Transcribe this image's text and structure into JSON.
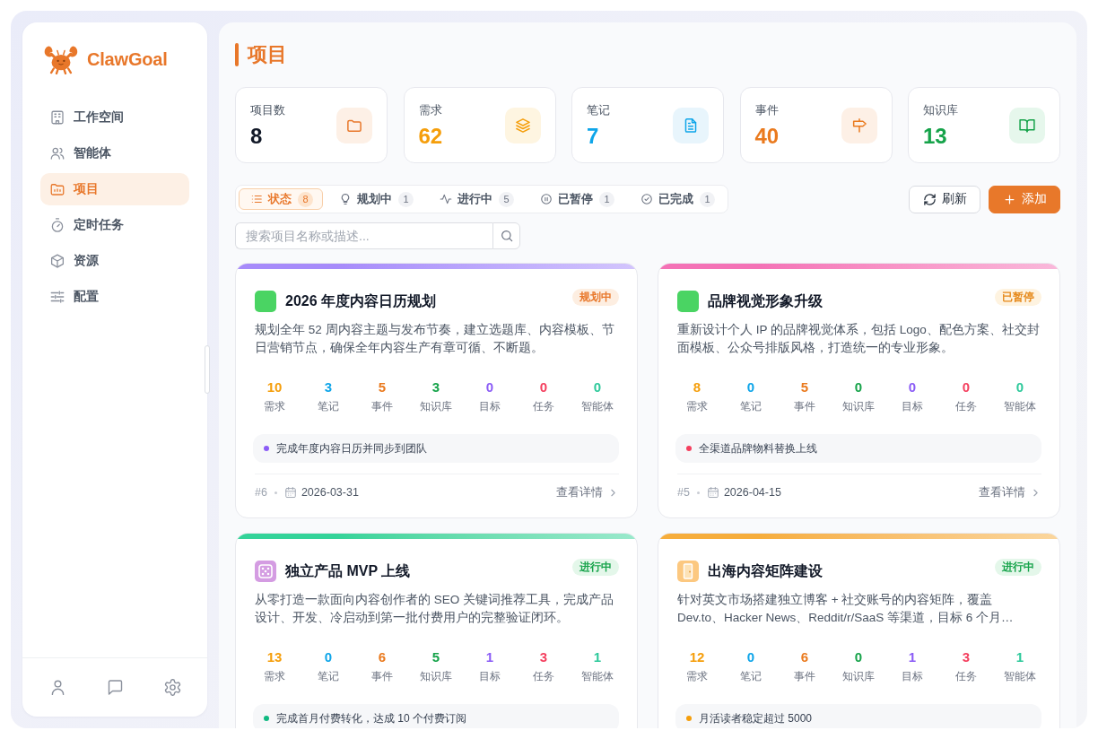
{
  "sidebar": {
    "logo": "ClawGoal",
    "items": [
      {
        "label": "工作空间",
        "selected": false
      },
      {
        "label": "智能体",
        "selected": false
      },
      {
        "label": "项目",
        "selected": true
      },
      {
        "label": "定时任务",
        "selected": false
      },
      {
        "label": "资源",
        "selected": false
      },
      {
        "label": "配置",
        "selected": false
      }
    ]
  },
  "header": {
    "title": "项目"
  },
  "stats": [
    {
      "label": "项目数",
      "value": "8",
      "color": "#111827"
    },
    {
      "label": "需求",
      "value": "62",
      "color": "#f59e0b"
    },
    {
      "label": "笔记",
      "value": "7",
      "color": "#0ea5e9"
    },
    {
      "label": "事件",
      "value": "40",
      "color": "#ea7a1e"
    },
    {
      "label": "知识库",
      "value": "13",
      "color": "#16a34a"
    }
  ],
  "filter_tabs": [
    {
      "label": "状态",
      "count": "8",
      "selected": true
    },
    {
      "label": "规划中",
      "count": "1",
      "selected": false
    },
    {
      "label": "进行中",
      "count": "5",
      "selected": false
    },
    {
      "label": "已暂停",
      "count": "1",
      "selected": false
    },
    {
      "label": "已完成",
      "count": "1",
      "selected": false
    }
  ],
  "actions": [
    {
      "label": "刷新",
      "kind": "secondary"
    },
    {
      "label": "添加",
      "kind": "primary"
    }
  ],
  "search": {
    "placeholder": "搜索项目名称或描述..."
  },
  "projects": [
    {
      "title": "2026 年度内容日历规划",
      "color": "#a78bfa",
      "icon": {
        "color": "#4ad463"
      },
      "status": {
        "label": "规划中",
        "kind": "planning"
      },
      "description": "规划全年 52 周内容主题与发布节奏，建立选题库、内容模板、节日营销节点，确保全年内容生产有章可循、不断题。",
      "metrics": [
        {
          "value": "10",
          "label": "需求",
          "color": "#f59e0b"
        },
        {
          "value": "3",
          "label": "笔记",
          "color": "#0ea5e9"
        },
        {
          "value": "5",
          "label": "事件",
          "color": "#ea7a1e"
        },
        {
          "value": "3",
          "label": "知识库",
          "color": "#16a34a"
        },
        {
          "value": "0",
          "label": "目标",
          "color": "#8b5cf6"
        },
        {
          "value": "0",
          "label": "任务",
          "color": "#f43f5e"
        },
        {
          "value": "0",
          "label": "智能体",
          "color": "#2ec99b"
        }
      ],
      "milestone": {
        "text": "完成年度内容日历并同步到团队",
        "color": "#8b5cf6"
      },
      "footer": {
        "number": "#6",
        "date": "2026-03-31",
        "link": "查看详情"
      }
    },
    {
      "title": "品牌视觉形象升级",
      "color": "#f472b6",
      "icon": {
        "color": "#4ad463"
      },
      "status": {
        "label": "已暂停",
        "kind": "paused"
      },
      "description": "重新设计个人 IP 的品牌视觉体系，包括 Logo、配色方案、社交封面模板、公众号排版风格，打造统一的专业形象。",
      "metrics": [
        {
          "value": "8",
          "label": "需求",
          "color": "#f59e0b"
        },
        {
          "value": "0",
          "label": "笔记",
          "color": "#0ea5e9"
        },
        {
          "value": "5",
          "label": "事件",
          "color": "#ea7a1e"
        },
        {
          "value": "0",
          "label": "知识库",
          "color": "#16a34a"
        },
        {
          "value": "0",
          "label": "目标",
          "color": "#8b5cf6"
        },
        {
          "value": "0",
          "label": "任务",
          "color": "#f43f5e"
        },
        {
          "value": "0",
          "label": "智能体",
          "color": "#2ec99b"
        }
      ],
      "milestone": {
        "text": "全渠道品牌物料替换上线",
        "color": "#f43f5e"
      },
      "footer": {
        "number": "#5",
        "date": "2026-04-15",
        "link": "查看详情"
      }
    },
    {
      "title": "独立产品 MVP 上线",
      "color": "#34d399",
      "icon": {
        "color": "#d49ce2"
      },
      "status": {
        "label": "进行中",
        "kind": "active"
      },
      "description": "从零打造一款面向内容创作者的 SEO 关键词推荐工具，完成产品设计、开发、冷启动到第一批付费用户的完整验证闭环。",
      "metrics": [
        {
          "value": "13",
          "label": "需求",
          "color": "#f59e0b"
        },
        {
          "value": "0",
          "label": "笔记",
          "color": "#0ea5e9"
        },
        {
          "value": "6",
          "label": "事件",
          "color": "#ea7a1e"
        },
        {
          "value": "5",
          "label": "知识库",
          "color": "#16a34a"
        },
        {
          "value": "1",
          "label": "目标",
          "color": "#8b5cf6"
        },
        {
          "value": "3",
          "label": "任务",
          "color": "#f43f5e"
        },
        {
          "value": "1",
          "label": "智能体",
          "color": "#2ec99b"
        }
      ],
      "milestone": {
        "text": "完成首月付费转化，达成 10 个付费订阅",
        "color": "#10b981"
      }
    },
    {
      "title": "出海内容矩阵建设",
      "color": "#f6ad3c",
      "icon": {
        "color": "#fcc880"
      },
      "status": {
        "label": "进行中",
        "kind": "active"
      },
      "description": "针对英文市场搭建独立博客 + 社交账号的内容矩阵，覆盖 Dev.to、Hacker News、Reddit/r/SaaS 等渠道，目标 6 个月…",
      "metrics": [
        {
          "value": "12",
          "label": "需求",
          "color": "#f59e0b"
        },
        {
          "value": "0",
          "label": "笔记",
          "color": "#0ea5e9"
        },
        {
          "value": "6",
          "label": "事件",
          "color": "#ea7a1e"
        },
        {
          "value": "0",
          "label": "知识库",
          "color": "#16a34a"
        },
        {
          "value": "1",
          "label": "目标",
          "color": "#8b5cf6"
        },
        {
          "value": "3",
          "label": "任务",
          "color": "#f43f5e"
        },
        {
          "value": "1",
          "label": "智能体",
          "color": "#2ec99b"
        }
      ],
      "milestone": {
        "text": "月活读者稳定超过 5000",
        "color": "#f59e0b"
      }
    }
  ]
}
